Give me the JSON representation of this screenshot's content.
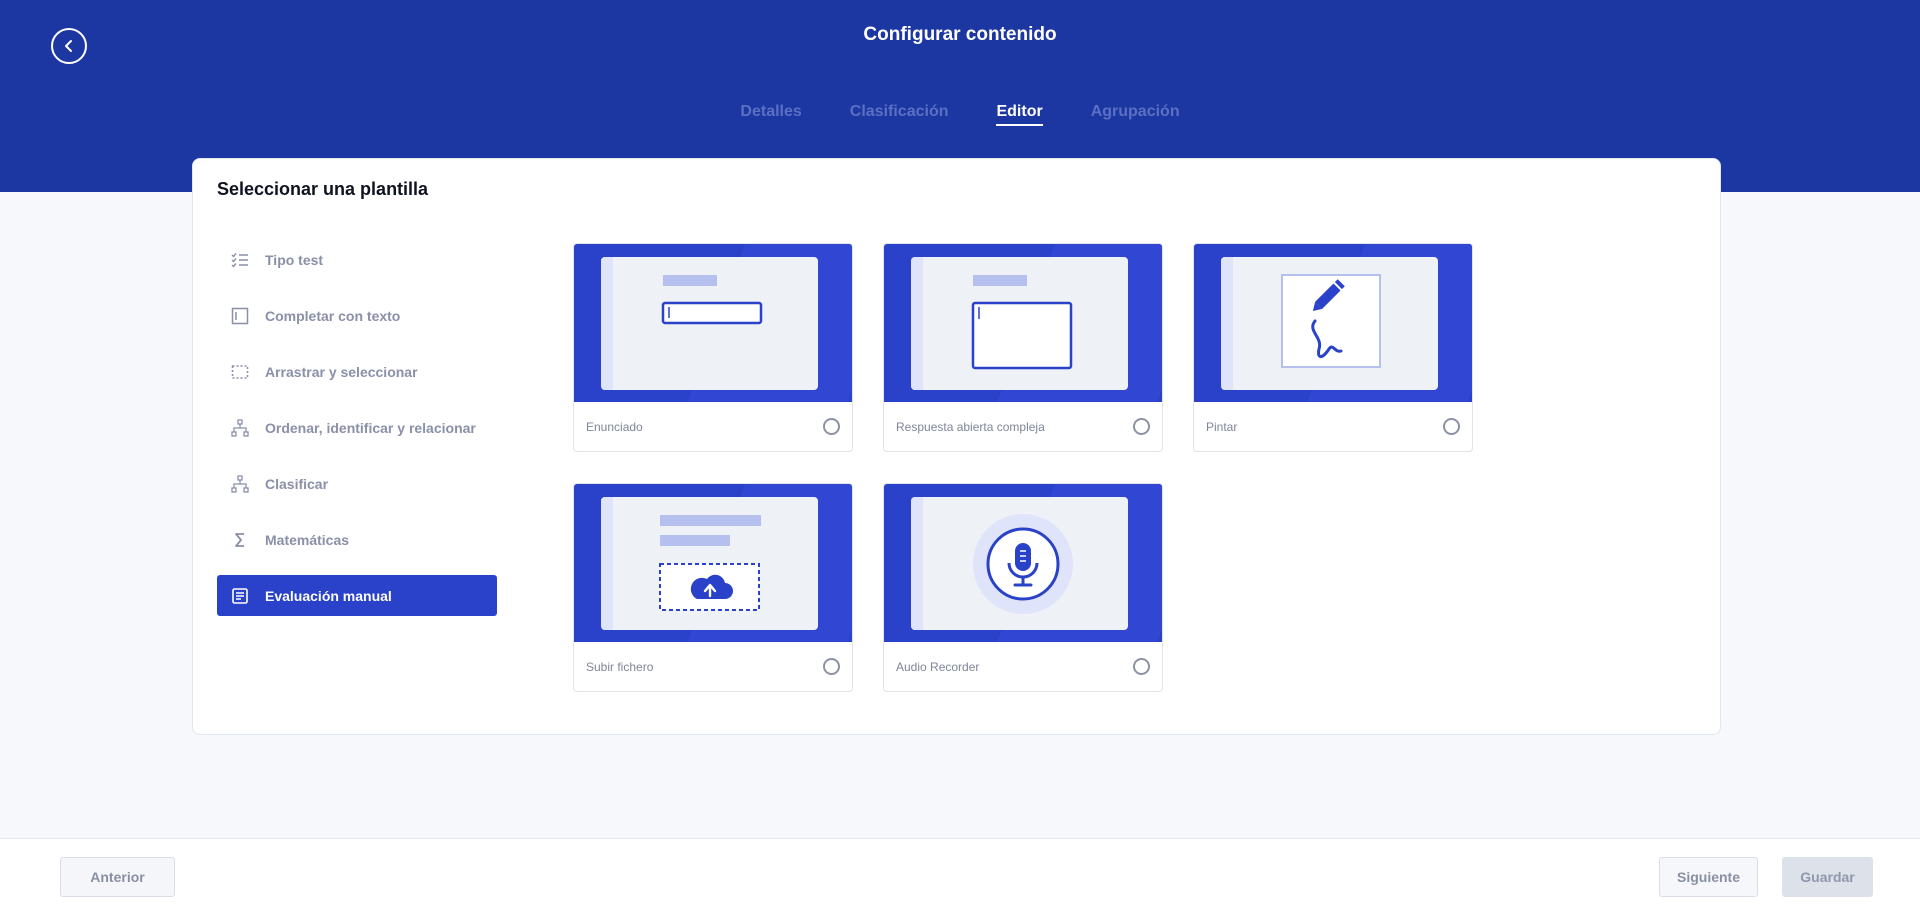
{
  "header": {
    "title": "Configurar contenido",
    "tabs": [
      {
        "label": "Detalles",
        "active": false
      },
      {
        "label": "Clasificación",
        "active": false
      },
      {
        "label": "Editor",
        "active": true
      },
      {
        "label": "Agrupación",
        "active": false
      }
    ]
  },
  "panel": {
    "title": "Seleccionar una plantilla",
    "categories": [
      {
        "label": "Tipo test",
        "icon": "checklist-icon",
        "active": false
      },
      {
        "label": "Completar con texto",
        "icon": "text-box-icon",
        "active": false
      },
      {
        "label": "Arrastrar y seleccionar",
        "icon": "dashed-select-icon",
        "active": false
      },
      {
        "label": "Ordenar, identificar y relacionar",
        "icon": "hierarchy-icon",
        "active": false
      },
      {
        "label": "Clasificar",
        "icon": "hierarchy-icon",
        "active": false
      },
      {
        "label": "Matemáticas",
        "icon": "sigma-icon",
        "active": false
      },
      {
        "label": "Evaluación manual",
        "icon": "document-icon",
        "active": true
      }
    ],
    "templates": [
      {
        "label": "Enunciado",
        "icon": "statement-field-icon",
        "selected": false
      },
      {
        "label": "Respuesta abierta compleja",
        "icon": "open-answer-field-icon",
        "selected": false
      },
      {
        "label": "Pintar",
        "icon": "pencil-drawing-icon",
        "selected": false
      },
      {
        "label": "Subir fichero",
        "icon": "cloud-upload-icon",
        "selected": false
      },
      {
        "label": "Audio Recorder",
        "icon": "microphone-icon",
        "selected": false
      }
    ]
  },
  "footer": {
    "prev_label": "Anterior",
    "next_label": "Siguiente",
    "save_label": "Guardar"
  },
  "colors": {
    "brand": "#1d37a2",
    "accent": "#2a41c9"
  }
}
